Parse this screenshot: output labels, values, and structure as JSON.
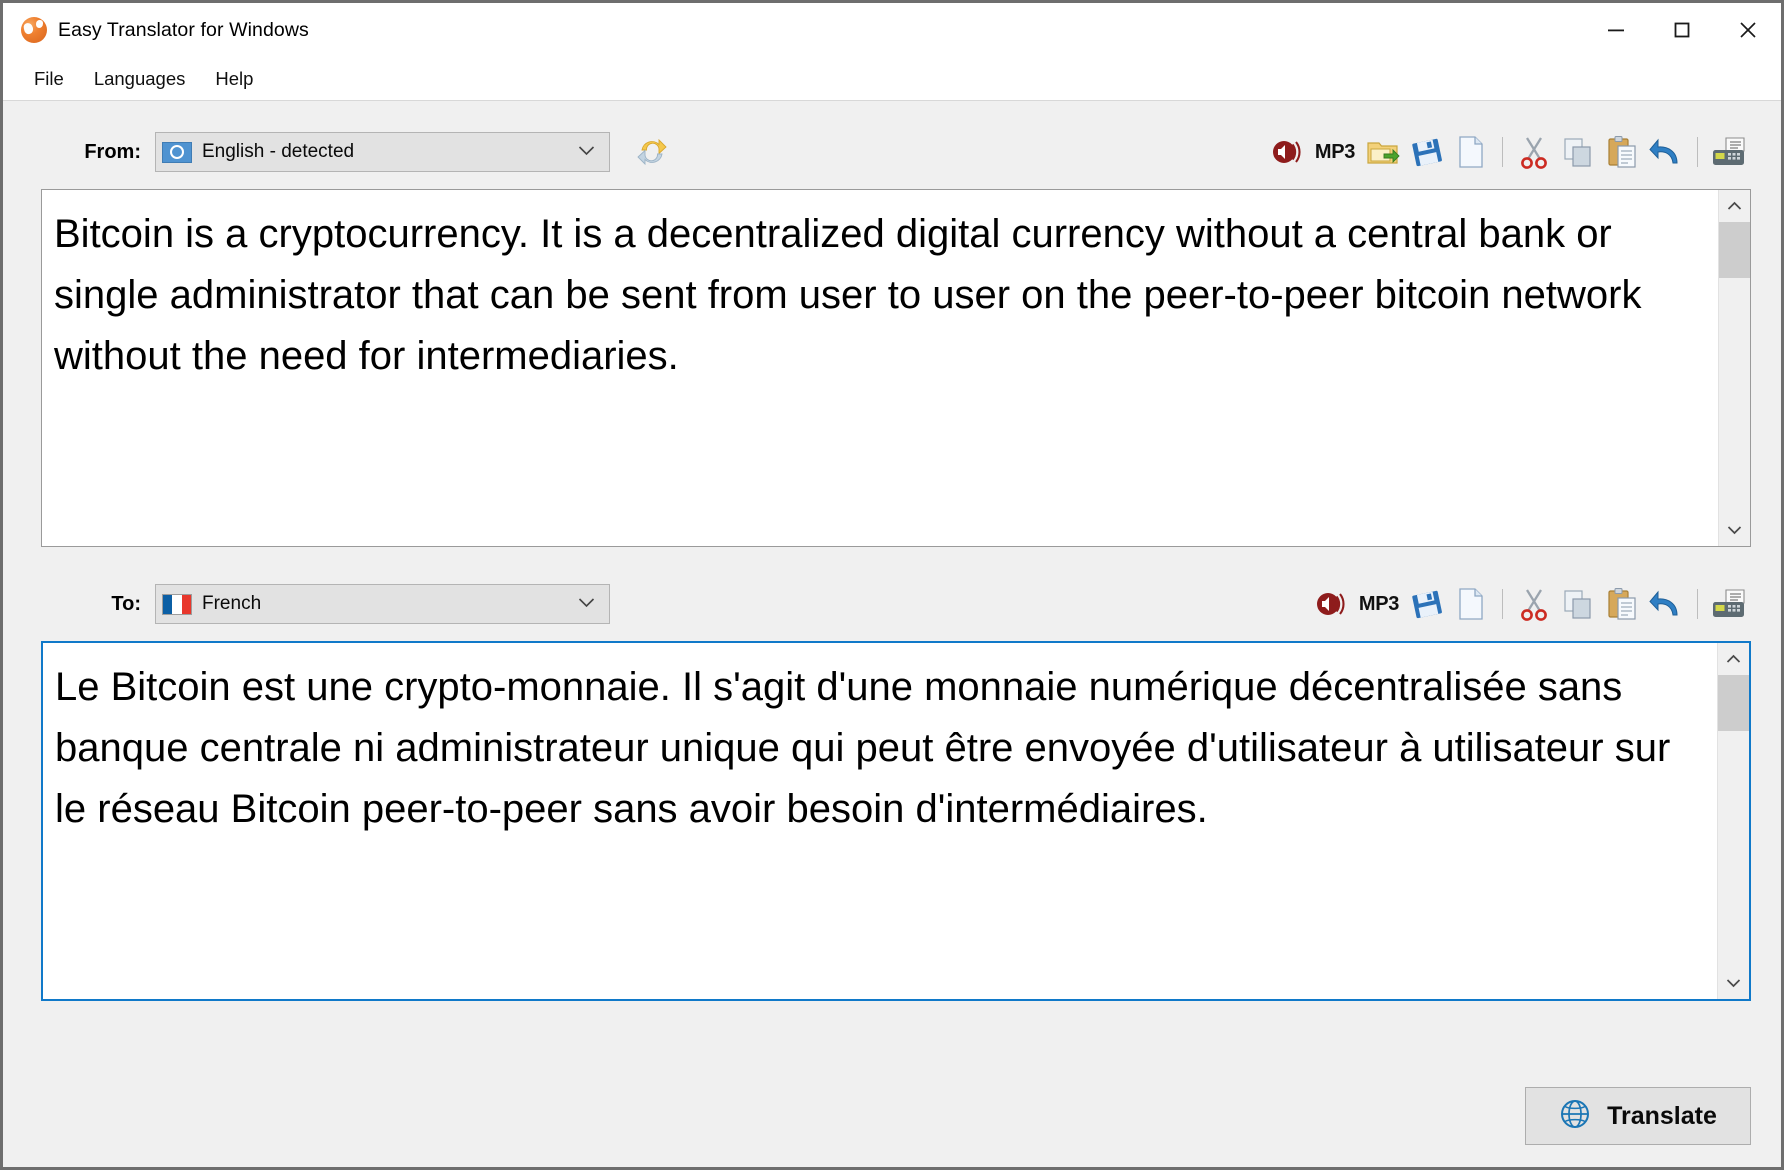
{
  "window": {
    "title": "Easy Translator for Windows",
    "app_icon": "globe-orange-icon",
    "controls": {
      "minimize": "minimize-icon",
      "maximize": "maximize-icon",
      "close": "close-icon"
    }
  },
  "menubar": {
    "items": [
      {
        "label": "File"
      },
      {
        "label": "Languages"
      },
      {
        "label": "Help"
      }
    ]
  },
  "source": {
    "label": "From:",
    "language": "English - detected",
    "flag": "un-flag-icon",
    "swap_icon": "refresh-swap-icon",
    "text": "Bitcoin is a cryptocurrency. It is a decentralized digital currency without a central bank or single administrator that can be sent from user to user on the peer-to-peer bitcoin network without the need for intermediaries.",
    "toolbar": [
      {
        "name": "speak-icon",
        "label": ""
      },
      {
        "name": "mp3-label",
        "label": "MP3"
      },
      {
        "name": "open-folder-icon",
        "label": ""
      },
      {
        "name": "save-icon",
        "label": ""
      },
      {
        "name": "new-document-icon",
        "label": ""
      },
      {
        "name": "separator",
        "label": ""
      },
      {
        "name": "cut-icon",
        "label": ""
      },
      {
        "name": "copy-icon",
        "label": ""
      },
      {
        "name": "paste-icon",
        "label": ""
      },
      {
        "name": "undo-icon",
        "label": ""
      },
      {
        "name": "separator",
        "label": ""
      },
      {
        "name": "print-fax-icon",
        "label": ""
      }
    ]
  },
  "target": {
    "label": "To:",
    "language": "French",
    "flag": "fr-flag-icon",
    "text": "Le Bitcoin est une crypto-monnaie. Il s'agit d'une monnaie numérique décentralisée sans banque centrale ni administrateur unique qui peut être envoyée d'utilisateur à utilisateur sur le réseau Bitcoin peer-to-peer sans avoir besoin d'intermédiaires.",
    "toolbar": [
      {
        "name": "speak-icon",
        "label": ""
      },
      {
        "name": "mp3-label",
        "label": "MP3"
      },
      {
        "name": "save-icon",
        "label": ""
      },
      {
        "name": "new-document-icon",
        "label": ""
      },
      {
        "name": "separator",
        "label": ""
      },
      {
        "name": "cut-icon",
        "label": ""
      },
      {
        "name": "copy-icon",
        "label": ""
      },
      {
        "name": "paste-icon",
        "label": ""
      },
      {
        "name": "undo-icon",
        "label": ""
      },
      {
        "name": "separator",
        "label": ""
      },
      {
        "name": "print-fax-icon",
        "label": ""
      }
    ]
  },
  "actions": {
    "translate_label": "Translate",
    "translate_icon": "globe-wire-icon"
  },
  "colors": {
    "window_bg": "#f0f0f0",
    "titlebar_bg": "#ffffff",
    "combo_bg": "#e2e2e2",
    "focus_border": "#1079c9",
    "panel_border": "#9a9a9a",
    "scroll_thumb": "#cdcdcd",
    "accent_orange": "#ef8030"
  }
}
